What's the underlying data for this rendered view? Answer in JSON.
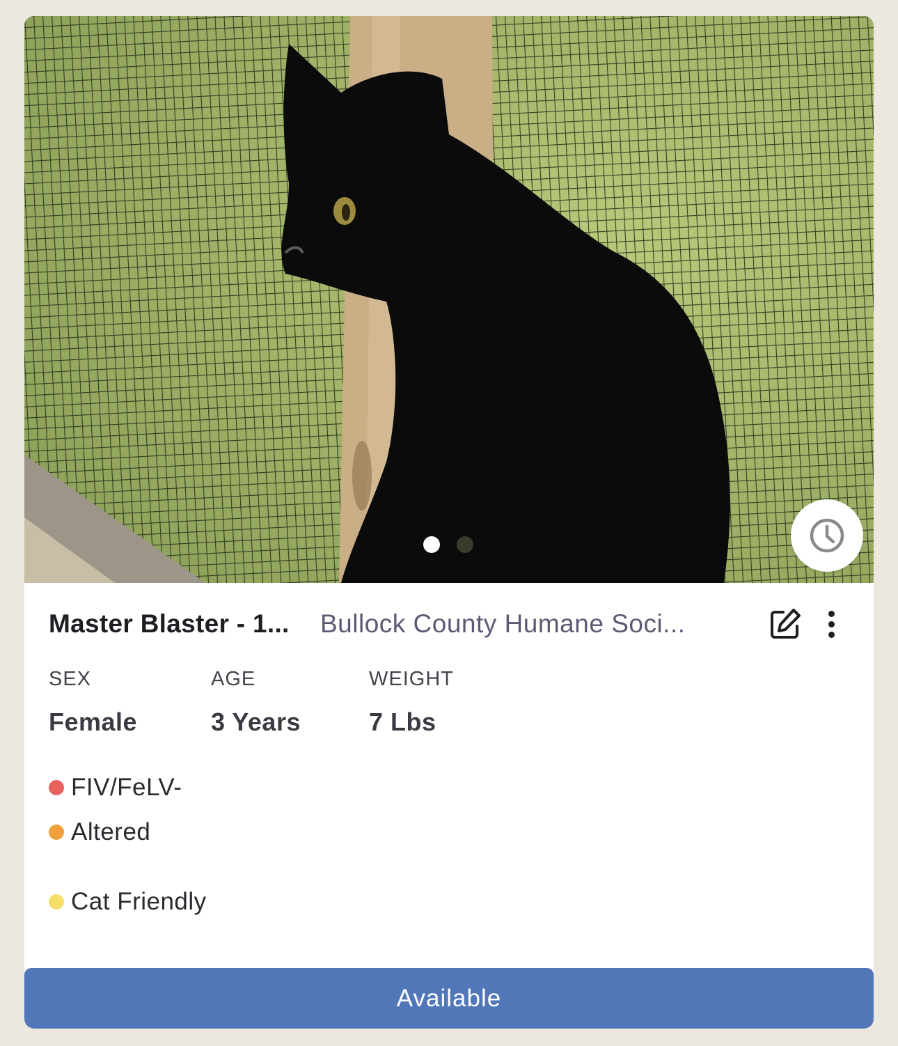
{
  "card": {
    "name": "Master Blaster - 1...",
    "organization": "Bullock County Humane Soci...",
    "photo": {
      "total": 2,
      "active_index": 0
    },
    "stats": [
      {
        "label": "SEX",
        "value": "Female"
      },
      {
        "label": "AGE",
        "value": "3 Years"
      },
      {
        "label": "WEIGHT",
        "value": "7 Lbs"
      }
    ],
    "tags": [
      {
        "label": "FIV/FeLV-",
        "color": "#e7625e"
      },
      {
        "label": "Altered",
        "color": "#f0a039"
      },
      {
        "label": "Cat Friendly",
        "color": "#f5de6a"
      }
    ],
    "status_label": "Available",
    "status_color": "#5277b9"
  },
  "icons": {
    "history": "clock-icon",
    "edit": "edit-icon",
    "more": "more-vertical-icon"
  }
}
